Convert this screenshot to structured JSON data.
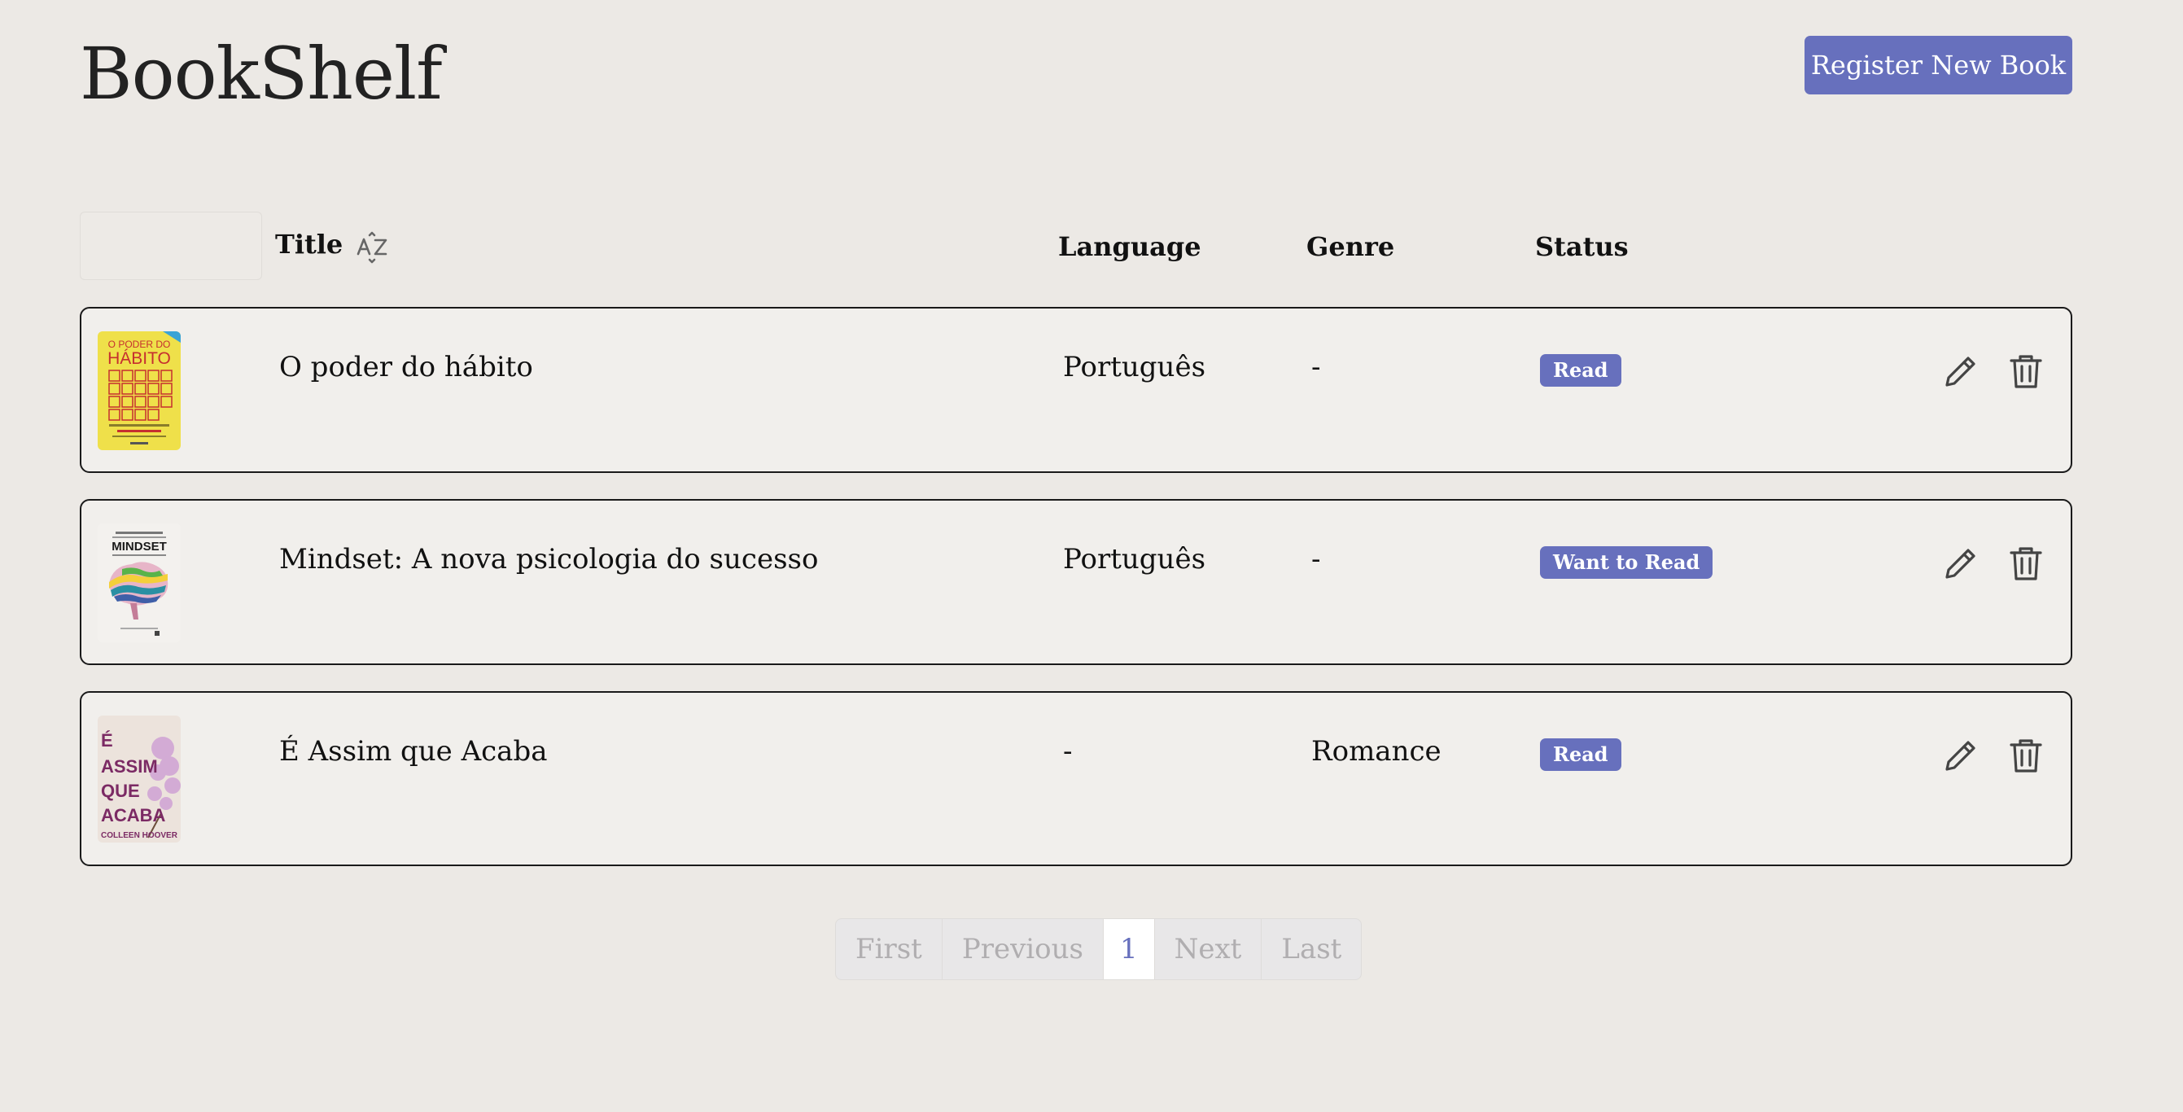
{
  "app": {
    "title": "BookShelf",
    "register_label": "Register New Book"
  },
  "table": {
    "headers": {
      "title": "Title",
      "sort_icon": "sort-alpha-icon",
      "language": "Language",
      "genre": "Genre",
      "status": "Status"
    },
    "rows": [
      {
        "title": "O poder do hábito",
        "language": "Português",
        "genre": "-",
        "status": "Read",
        "cover_text": [
          "O PODER DO",
          "HÁBITO"
        ]
      },
      {
        "title": "Mindset: A nova psicologia do sucesso",
        "language": "Português",
        "genre": "-",
        "status": "Want to Read",
        "cover_text": [
          "MINDSET"
        ]
      },
      {
        "title": "É Assim que Acaba",
        "language": "-",
        "genre": "Romance",
        "status": "Read",
        "cover_text": [
          "É",
          "ASSIM",
          "QUE",
          "ACABA",
          "COLLEEN HOOVER"
        ]
      }
    ]
  },
  "pagination": {
    "first": "First",
    "previous": "Previous",
    "current": "1",
    "next": "Next",
    "last": "Last"
  },
  "colors": {
    "accent": "#6770bd",
    "background": "#ece9e5",
    "row_background": "#f1efec"
  }
}
